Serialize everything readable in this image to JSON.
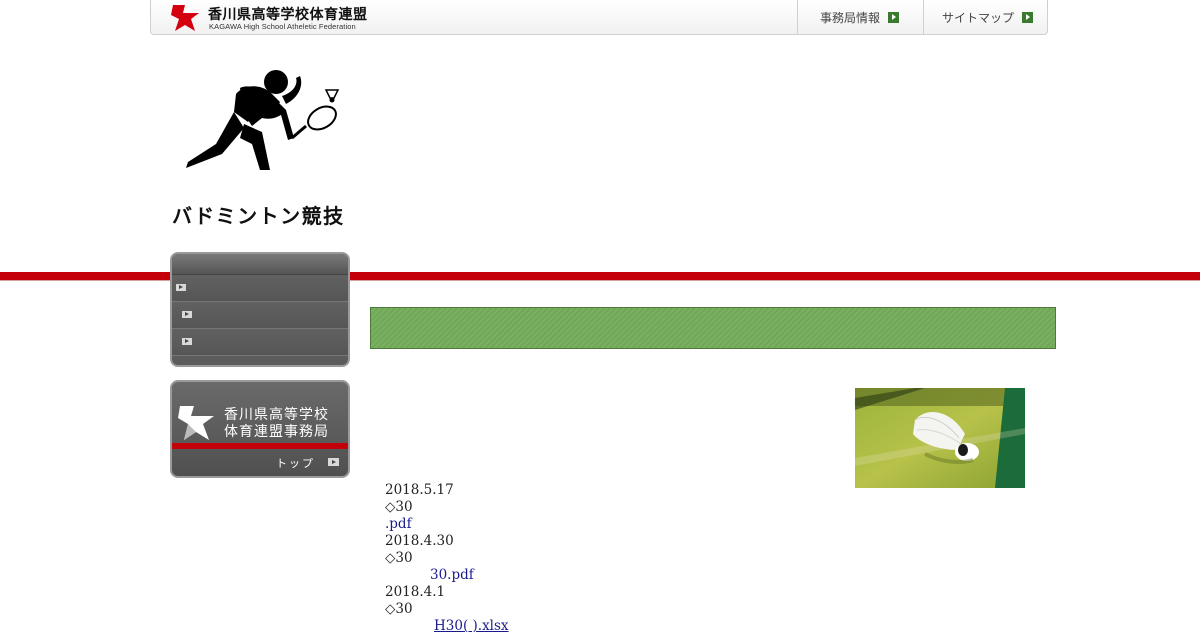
{
  "header": {
    "logo_title": "香川県高等学校体育連盟",
    "logo_subtitle": "KAGAWA High School Atheletic Federation",
    "nav": [
      {
        "label": "事務局情報"
      },
      {
        "label": "サイトマップ"
      }
    ]
  },
  "sport": {
    "title": "バドミントン競技"
  },
  "side_banner": {
    "line1": "香川県高等学校",
    "line2": "体育連盟事務局",
    "top_link": "トップ"
  },
  "content": {
    "entries": [
      {
        "date": "2018.5.17",
        "marker": "◇30",
        "link": ".pdf"
      },
      {
        "date": "2018.4.30",
        "marker": "◇30",
        "link": "30.pdf"
      },
      {
        "date": "2018.4.1",
        "marker": "◇30",
        "link": "H30( ).xlsx"
      }
    ]
  },
  "colors": {
    "accent_red": "#c4000b",
    "green_bar": "#6fa857",
    "menu_gray": "#5c5c5c",
    "link_blue": "#1a1a8c"
  }
}
